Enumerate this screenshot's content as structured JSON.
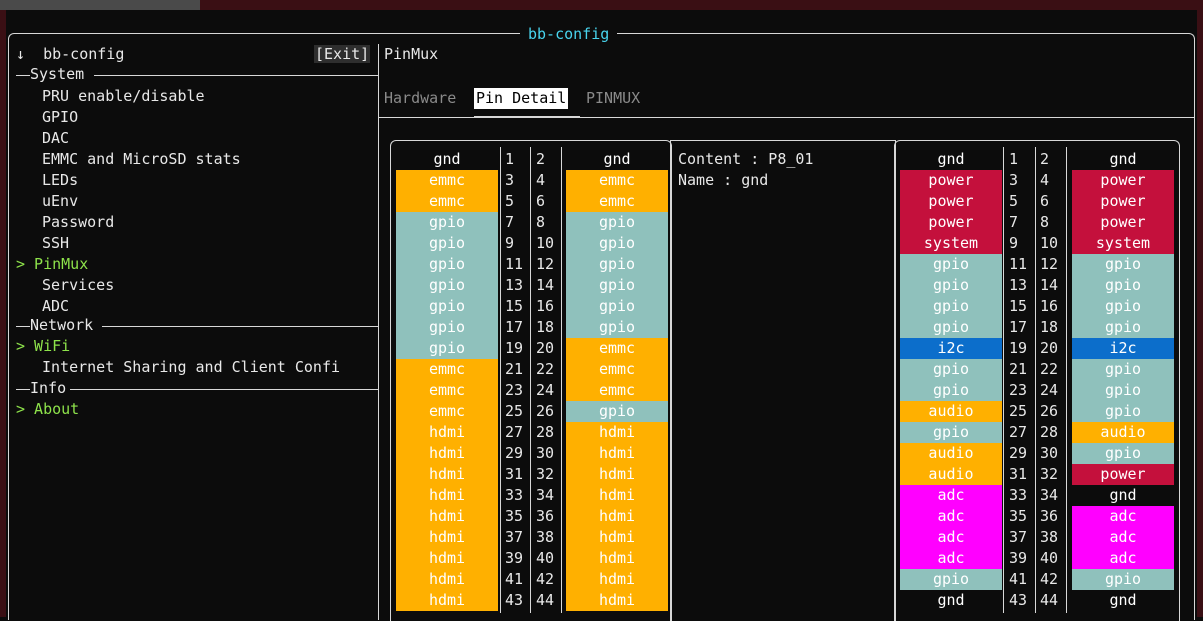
{
  "window": {
    "title": "bb-config"
  },
  "sidebar": {
    "header": "↓  bb-config",
    "exit_label": "[Exit]",
    "groups": [
      {
        "label": "System"
      },
      {
        "label": "Network"
      },
      {
        "label": "Info"
      }
    ],
    "items": [
      {
        "label": "PRU enable/disable",
        "selected": false
      },
      {
        "label": "GPIO",
        "selected": false
      },
      {
        "label": "DAC",
        "selected": false
      },
      {
        "label": "EMMC and MicroSD stats",
        "selected": false
      },
      {
        "label": "LEDs",
        "selected": false
      },
      {
        "label": "uEnv",
        "selected": false
      },
      {
        "label": "Password",
        "selected": false
      },
      {
        "label": "SSH",
        "selected": false
      },
      {
        "label": "> PinMux",
        "selected": true
      },
      {
        "label": "Services",
        "selected": false
      },
      {
        "label": "ADC",
        "selected": false
      },
      {
        "label": "> WiFi",
        "selected": true
      },
      {
        "label": "Internet Sharing and Client Confi",
        "selected": false
      },
      {
        "label": "> About",
        "selected": true
      }
    ]
  },
  "main": {
    "title": "PinMux",
    "tabs": [
      {
        "label": "Hardware",
        "active": false
      },
      {
        "label": "Pin Detail",
        "active": true
      },
      {
        "label": "PINMUX",
        "active": false
      }
    ],
    "detail": {
      "content_line": "Content : P8_01",
      "name_line": "Name : gnd"
    },
    "colors": {
      "gnd": "#0c0c0c",
      "emmc": "#ffb000",
      "gpio": "#8fc1bc",
      "hdmi": "#ffb000",
      "power": "#c4103c",
      "system": "#c4103c",
      "i2c": "#0c6ecb",
      "audio": "#ffb000",
      "adc": "#ff00ff"
    },
    "p8": {
      "left": [
        "gnd",
        "emmc",
        "emmc",
        "gpio",
        "gpio",
        "gpio",
        "gpio",
        "gpio",
        "gpio",
        "gpio",
        "emmc",
        "emmc",
        "emmc",
        "hdmi",
        "hdmi",
        "hdmi",
        "hdmi",
        "hdmi",
        "hdmi",
        "hdmi",
        "hdmi",
        "hdmi"
      ],
      "right": [
        "gnd",
        "emmc",
        "emmc",
        "gpio",
        "gpio",
        "gpio",
        "gpio",
        "gpio",
        "gpio",
        "emmc",
        "emmc",
        "emmc",
        "gpio",
        "hdmi",
        "hdmi",
        "hdmi",
        "hdmi",
        "hdmi",
        "hdmi",
        "hdmi",
        "hdmi",
        "hdmi"
      ],
      "odd": [
        "1",
        "3",
        "5",
        "7",
        "9",
        "11",
        "13",
        "15",
        "17",
        "19",
        "21",
        "23",
        "25",
        "27",
        "29",
        "31",
        "33",
        "35",
        "37",
        "39",
        "41",
        "43"
      ],
      "even": [
        "2",
        "4",
        "6",
        "8",
        "10",
        "12",
        "14",
        "16",
        "18",
        "20",
        "22",
        "24",
        "26",
        "28",
        "30",
        "32",
        "34",
        "36",
        "38",
        "40",
        "42",
        "44"
      ]
    },
    "p9": {
      "left": [
        "gnd",
        "power",
        "power",
        "power",
        "system",
        "gpio",
        "gpio",
        "gpio",
        "gpio",
        "i2c",
        "gpio",
        "gpio",
        "audio",
        "gpio",
        "audio",
        "audio",
        "adc",
        "adc",
        "adc",
        "adc",
        "gpio",
        "gnd"
      ],
      "right": [
        "gnd",
        "power",
        "power",
        "power",
        "system",
        "gpio",
        "gpio",
        "gpio",
        "gpio",
        "i2c",
        "gpio",
        "gpio",
        "gpio",
        "audio",
        "gpio",
        "power",
        "gnd",
        "adc",
        "adc",
        "adc",
        "gpio",
        "gnd"
      ],
      "odd": [
        "1",
        "3",
        "5",
        "7",
        "9",
        "11",
        "13",
        "15",
        "17",
        "19",
        "21",
        "23",
        "25",
        "27",
        "29",
        "31",
        "33",
        "35",
        "37",
        "39",
        "41",
        "43"
      ],
      "even": [
        "2",
        "4",
        "6",
        "8",
        "10",
        "12",
        "14",
        "16",
        "18",
        "20",
        "22",
        "24",
        "26",
        "28",
        "30",
        "32",
        "34",
        "36",
        "38",
        "40",
        "42",
        "44"
      ]
    }
  }
}
